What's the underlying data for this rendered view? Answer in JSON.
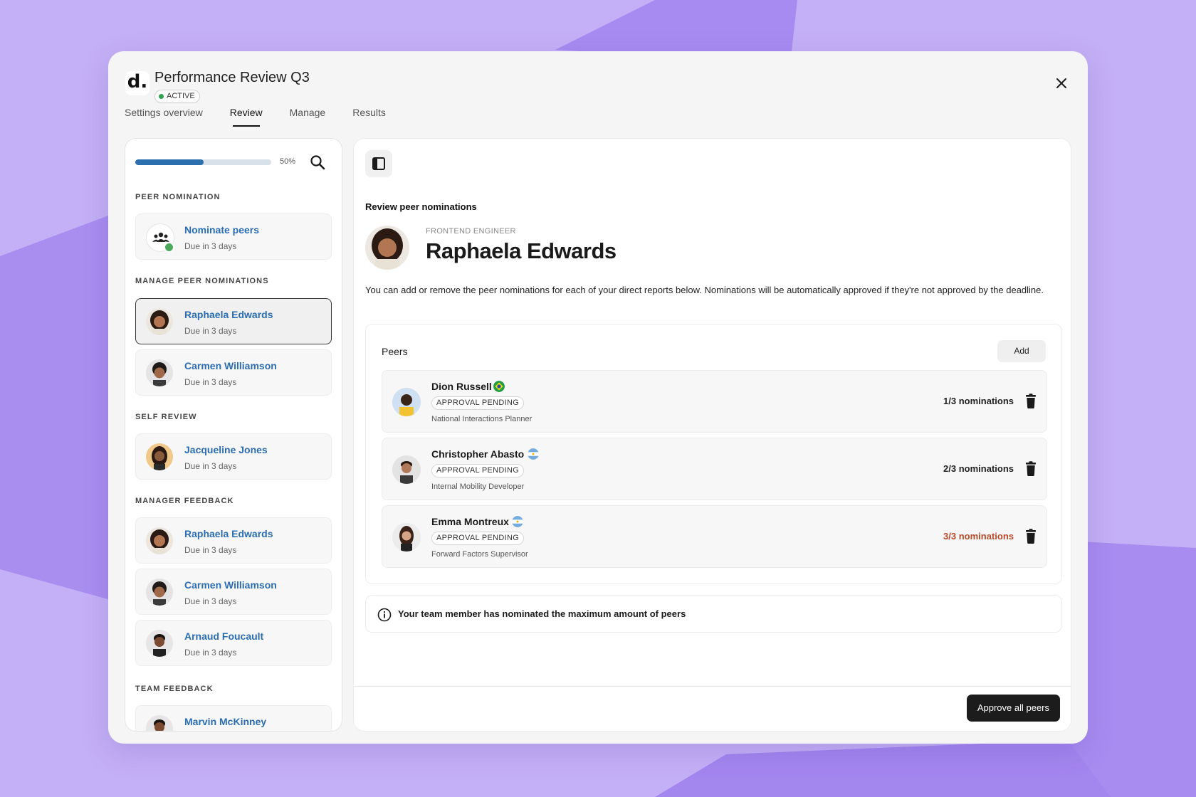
{
  "window": {
    "logo_text": "d.",
    "title": "Performance Review Q3",
    "status": "ACTIVE"
  },
  "tabs": [
    {
      "label": "Settings overview",
      "active": false
    },
    {
      "label": "Review",
      "active": true
    },
    {
      "label": "Manage",
      "active": false
    },
    {
      "label": "Results",
      "active": false
    }
  ],
  "sidebar": {
    "progress_percent": 50,
    "progress_label": "50%",
    "sections": {
      "peer_nomination": "PEER NOMINATION",
      "manage_peer_nominations": "MANAGE PEER NOMINATIONS",
      "self_review": "SELF REVIEW",
      "manager_feedback": "MANAGER FEEDBACK",
      "team_feedback": "TEAM FEEDBACK"
    },
    "items": [
      {
        "name": "Nominate peers",
        "due": "Due in 3 days"
      },
      {
        "name": "Raphaela Edwards",
        "due": "Due in 3 days"
      },
      {
        "name": "Carmen Williamson",
        "due": "Due in 3 days"
      },
      {
        "name": "Jacqueline Jones",
        "due": "Due in 3 days"
      },
      {
        "name": "Raphaela Edwards",
        "due": "Due in 3 days"
      },
      {
        "name": "Carmen Williamson",
        "due": "Due in 3 days"
      },
      {
        "name": "Arnaud Foucault",
        "due": "Due in 3 days"
      },
      {
        "name": "Marvin McKinney",
        "due": ""
      }
    ]
  },
  "main": {
    "section_heading": "Review peer nominations",
    "profile": {
      "role": "FRONTEND ENGINEER",
      "name": "Raphaela Edwards"
    },
    "description": "You can add or remove the peer nominations for each of your direct reports below. Nominations will be automatically approved if they're not approved by the deadline.",
    "peers": {
      "title": "Peers",
      "add_label": "Add",
      "rows": [
        {
          "name": "Dion Russell",
          "flag": "brazil-flag",
          "status": "APPROVAL PENDING",
          "job": "National Interactions Planner",
          "count": "1/3 nominations"
        },
        {
          "name": "Christopher Abasto",
          "flag": "argentina-flag",
          "status": "APPROVAL PENDING",
          "job": "Internal Mobility Developer",
          "count": "2/3 nominations"
        },
        {
          "name": "Emma Montreux",
          "flag": "argentina-flag",
          "status": "APPROVAL PENDING",
          "job": "Forward Factors Supervisor",
          "count": "3/3 nominations"
        }
      ]
    },
    "info_banner": "Your team member has nominated the maximum amount of peers",
    "footer": {
      "approve_label": "Approve all peers"
    }
  },
  "colors": {
    "background": "#c2adf5",
    "accent_blue": "#2a6db2",
    "progress_fill": "#2b6fae",
    "status_green": "#2fa24f",
    "limit_reached": "#b54a2a",
    "primary_button": "#1c1c1c"
  }
}
